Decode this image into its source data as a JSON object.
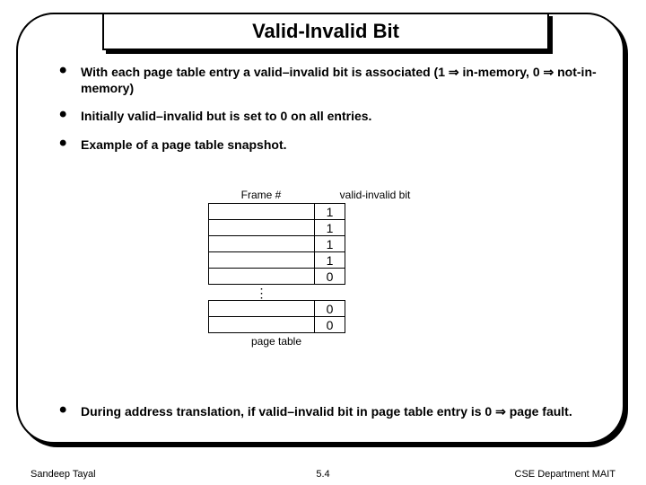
{
  "title": "Valid-Invalid Bit",
  "bullets": {
    "b1": "With each page table entry a valid–invalid bit is associated (1 ⇒ in-memory, 0 ⇒ not-in-memory)",
    "b2": "Initially valid–invalid but is set to 0 on all entries.",
    "b3": "Example of a page table snapshot.",
    "b4": "During address translation, if valid–invalid bit in page table entry is 0 ⇒ page fault."
  },
  "table": {
    "hdr_frame": "Frame #",
    "hdr_bit": "valid-invalid bit",
    "rows_top": [
      "1",
      "1",
      "1",
      "1",
      "0"
    ],
    "gap": "⋮",
    "rows_bottom": [
      "0",
      "0"
    ],
    "caption": "page table"
  },
  "footer": {
    "left": "Sandeep Tayal",
    "mid": "5.4",
    "right": "CSE Department MAIT"
  }
}
